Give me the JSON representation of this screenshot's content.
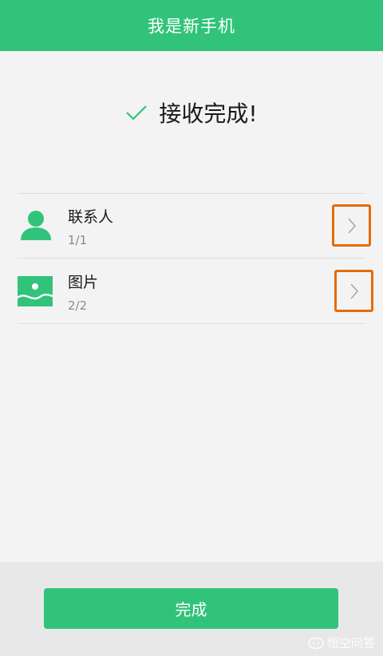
{
  "header": {
    "title": "我是新手机"
  },
  "status": {
    "text": "接收完成!"
  },
  "items": [
    {
      "title": "联系人",
      "count": "1/1",
      "icon": "person-icon"
    },
    {
      "title": "图片",
      "count": "2/2",
      "icon": "image-icon"
    }
  ],
  "footer": {
    "done_label": "完成"
  },
  "watermark": {
    "text": "悟空问答"
  },
  "colors": {
    "accent": "#32c37b",
    "highlight": "#e36c0a",
    "background": "#f3f3f3"
  }
}
